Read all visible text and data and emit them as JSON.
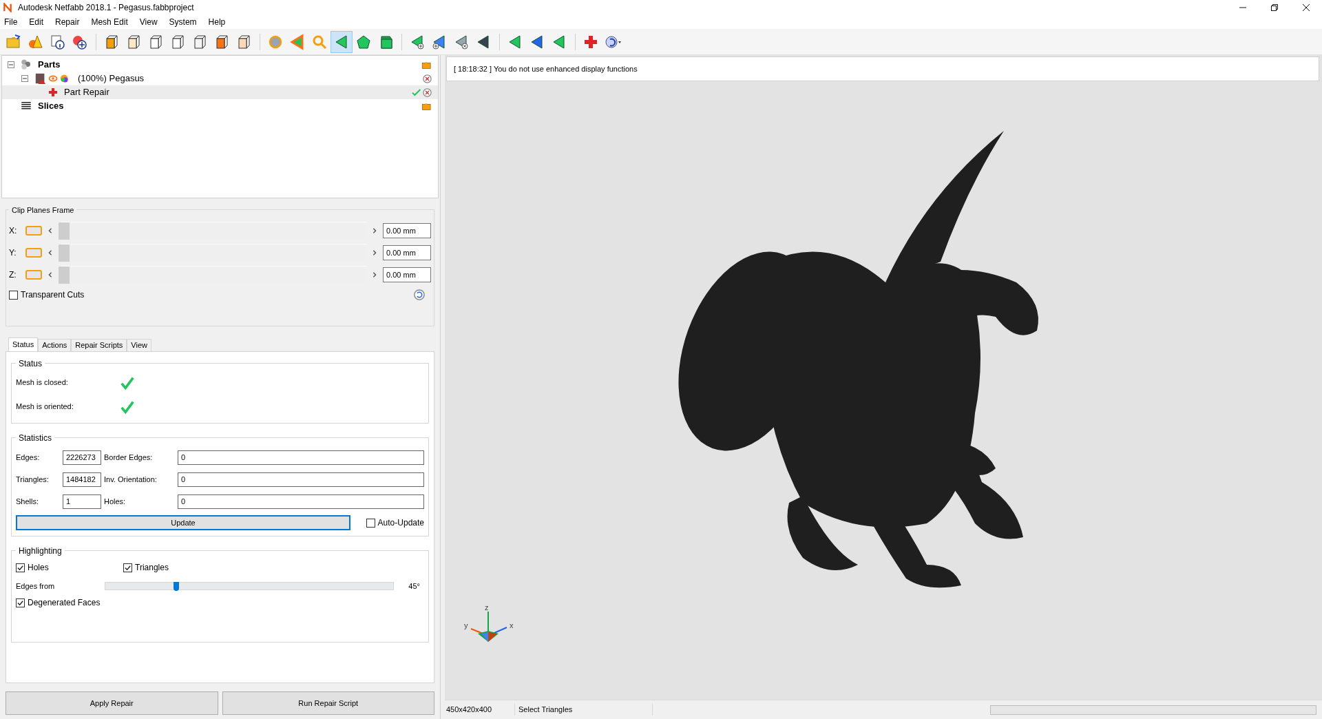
{
  "window": {
    "title": "Autodesk Netfabb 2018.1 - Pegasus.fabbproject"
  },
  "menu": [
    "File",
    "Edit",
    "Repair",
    "Mesh Edit",
    "View",
    "System",
    "Help"
  ],
  "toolbar": [
    [
      {
        "kind": "open",
        "selected": false
      },
      {
        "kind": "shapes",
        "selected": false
      },
      {
        "kind": "info",
        "selected": false
      },
      {
        "kind": "add",
        "selected": false
      }
    ],
    [
      {
        "kind": "cube-left",
        "selected": false
      },
      {
        "kind": "cube-front",
        "selected": false
      },
      {
        "kind": "cube-right",
        "selected": false
      },
      {
        "kind": "cube-back",
        "selected": false
      },
      {
        "kind": "cube-plain",
        "selected": false
      },
      {
        "kind": "cube-top",
        "selected": false
      },
      {
        "kind": "cube-iso",
        "selected": false
      }
    ],
    [
      {
        "kind": "sphere",
        "selected": false
      },
      {
        "kind": "arrow",
        "selected": false
      },
      {
        "kind": "magnifier",
        "selected": false
      },
      {
        "kind": "triangle",
        "selected": true
      },
      {
        "kind": "pentagon",
        "selected": false
      },
      {
        "kind": "shell",
        "selected": false
      }
    ],
    [
      {
        "kind": "tri-add",
        "selected": false
      },
      {
        "kind": "tri-add-blue",
        "selected": false
      },
      {
        "kind": "tri-remove",
        "selected": false
      },
      {
        "kind": "tri-dark",
        "selected": false
      }
    ],
    [
      {
        "kind": "tri-green",
        "selected": false
      },
      {
        "kind": "tri-blue",
        "selected": false
      },
      {
        "kind": "tri-green",
        "selected": false
      }
    ],
    [
      {
        "kind": "repair",
        "selected": false
      },
      {
        "kind": "dropdown",
        "selected": false
      }
    ]
  ],
  "tree": [
    {
      "label": "Parts",
      "kind": "parts",
      "selected": false,
      "children": [
        {
          "label": "(100%) Pegasus",
          "kind": "part",
          "selected": false,
          "children": [
            {
              "label": "Part Repair",
              "kind": "repair",
              "selected": true
            }
          ]
        }
      ]
    },
    {
      "label": "Slices",
      "kind": "slices",
      "selected": false
    }
  ],
  "clip_planes": {
    "title": "Clip Planes Frame",
    "rows": [
      {
        "axis": "X:",
        "value": "0.00 mm",
        "level": 0,
        "on": false
      },
      {
        "axis": "Y:",
        "value": "0.00 mm",
        "level": 0,
        "on": false
      },
      {
        "axis": "Z:",
        "value": "0.00 mm",
        "level": 0,
        "on": false
      }
    ],
    "transparent_cuts": {
      "label": "Transparent Cuts",
      "checked": false
    }
  },
  "tabs": [
    {
      "label": "Status",
      "selected": true
    },
    {
      "label": "Actions",
      "selected": false
    },
    {
      "label": "Repair Scripts",
      "selected": false
    },
    {
      "label": "View",
      "selected": false
    }
  ],
  "status_group": {
    "title": "Status",
    "rows": [
      {
        "label": "Mesh is closed:",
        "ok": true
      },
      {
        "label": "Mesh is oriented:",
        "ok": true
      }
    ]
  },
  "statistics": {
    "title": "Statistics",
    "rows": [
      {
        "label": "Edges:",
        "value": "2226273",
        "label2": "Border Edges:",
        "value2": "0"
      },
      {
        "label": "Triangles:",
        "value": "1484182",
        "label2": "Inv. Orientation:",
        "value2": "0"
      },
      {
        "label": "Shells:",
        "value": "1",
        "label2": "Holes:",
        "value2": "0"
      }
    ],
    "update": "Update",
    "auto_update": {
      "label": "Auto-Update",
      "checked": false
    }
  },
  "highlighting": {
    "title": "Highlighting",
    "holes": {
      "label": "Holes",
      "checked": true
    },
    "triangles": {
      "label": "Triangles",
      "checked": true
    },
    "edges": {
      "label": "Edges from",
      "level": 0.247,
      "reading": "45°"
    },
    "degenerated": {
      "label": "Degenerated Faces",
      "checked": true
    }
  },
  "buttons": [
    "Apply Repair",
    "Run Repair Script"
  ],
  "log": "[ 18:18:32 ] You do not use enhanced display functions",
  "axes": {
    "z": "z",
    "y": "y",
    "x": "x"
  },
  "status_bar": {
    "size": "450x420x400",
    "mode": "Select Triangles",
    "progress": {
      "level": 0
    }
  }
}
